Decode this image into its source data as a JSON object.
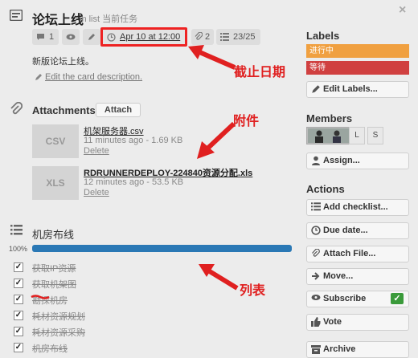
{
  "card": {
    "title": "论坛上线",
    "in_list": "in list 当前任务",
    "close": "×",
    "description": "新版论坛上线。",
    "edit_description": "Edit the card description."
  },
  "badges": {
    "comments": "1",
    "due": "Apr 10 at 12:00",
    "attachments": "2",
    "checklist": "23/25"
  },
  "annotations": {
    "due": "截止日期",
    "attachments": "附件",
    "list": "列表"
  },
  "attachments": {
    "title": "Attachments",
    "attach_button": "Attach",
    "files": [
      {
        "type": "CSV",
        "name": "机架服务器.csv",
        "meta": "11 minutes ago - 1.69 KB",
        "delete": "Delete"
      },
      {
        "type": "XLS",
        "name": "RDRUNNERDEPLOY-224840资源分配.xls",
        "meta": "12 minutes ago - 53.5 KB",
        "delete": "Delete"
      }
    ]
  },
  "checklist": {
    "title": "机房布线",
    "percent_label": "100%",
    "progress": 1.0,
    "items": [
      "获取IP资源",
      "获取机架图",
      "勘探机房",
      "耗材资源规划",
      "耗材资源采购",
      "机房布线"
    ]
  },
  "sidebar": {
    "labels_title": "Labels",
    "labels": [
      {
        "text": "进行中",
        "color": "#f0a040"
      },
      {
        "text": "等待",
        "color": "#d04040"
      }
    ],
    "edit_labels": "Edit Labels...",
    "members_title": "Members",
    "members": [
      "L",
      "S"
    ],
    "assign": "Assign...",
    "actions_title": "Actions",
    "actions": [
      {
        "label": "Add checklist...",
        "icon": "checklist-icon"
      },
      {
        "label": "Due date...",
        "icon": "clock-icon"
      },
      {
        "label": "Attach File...",
        "icon": "paperclip-icon"
      },
      {
        "label": "Move...",
        "icon": "arrow-right-icon"
      },
      {
        "label": "Subscribe",
        "icon": "eye-icon"
      },
      {
        "label": "Vote",
        "icon": "thumbs-up-icon"
      },
      {
        "label": "Archive",
        "icon": "archive-icon"
      }
    ]
  },
  "colors": {
    "accent": "#2a78b5",
    "annotation": "#e02020",
    "subscribe_check": "#3a9a3a"
  }
}
